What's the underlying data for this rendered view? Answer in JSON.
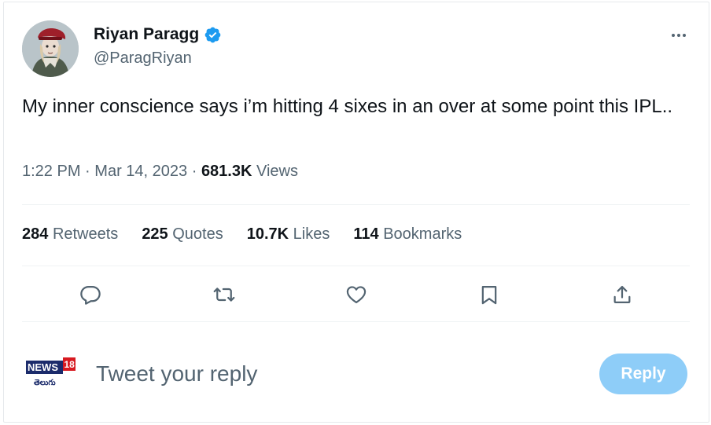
{
  "author": {
    "name": "Riyan Paragg",
    "handle": "@ParagRiyan",
    "verified": true,
    "verified_color": "#1d9bf0"
  },
  "tweet": {
    "text": "My inner conscience says i’m hitting 4 sixes in an over at some point this IPL..",
    "time": "1:22 PM",
    "separator": "·",
    "date": "Mar 14, 2023",
    "views_count": "681.3K",
    "views_label": "Views"
  },
  "stats": [
    {
      "count": "284",
      "label": "Retweets"
    },
    {
      "count": "225",
      "label": "Quotes"
    },
    {
      "count": "10.7K",
      "label": "Likes"
    },
    {
      "count": "114",
      "label": "Bookmarks"
    }
  ],
  "actions": [
    "reply-icon",
    "retweet-icon",
    "like-icon",
    "bookmark-icon",
    "share-icon"
  ],
  "reply_box": {
    "placeholder": "Tweet your reply",
    "button_label": "Reply",
    "button_color": "#8ecdf8"
  },
  "logo": {
    "text": "NEWS",
    "number": "18",
    "subtext": "తెలుగు"
  },
  "colors": {
    "text_primary": "#0f1419",
    "text_secondary": "#536471",
    "divider": "#eff3f4"
  }
}
